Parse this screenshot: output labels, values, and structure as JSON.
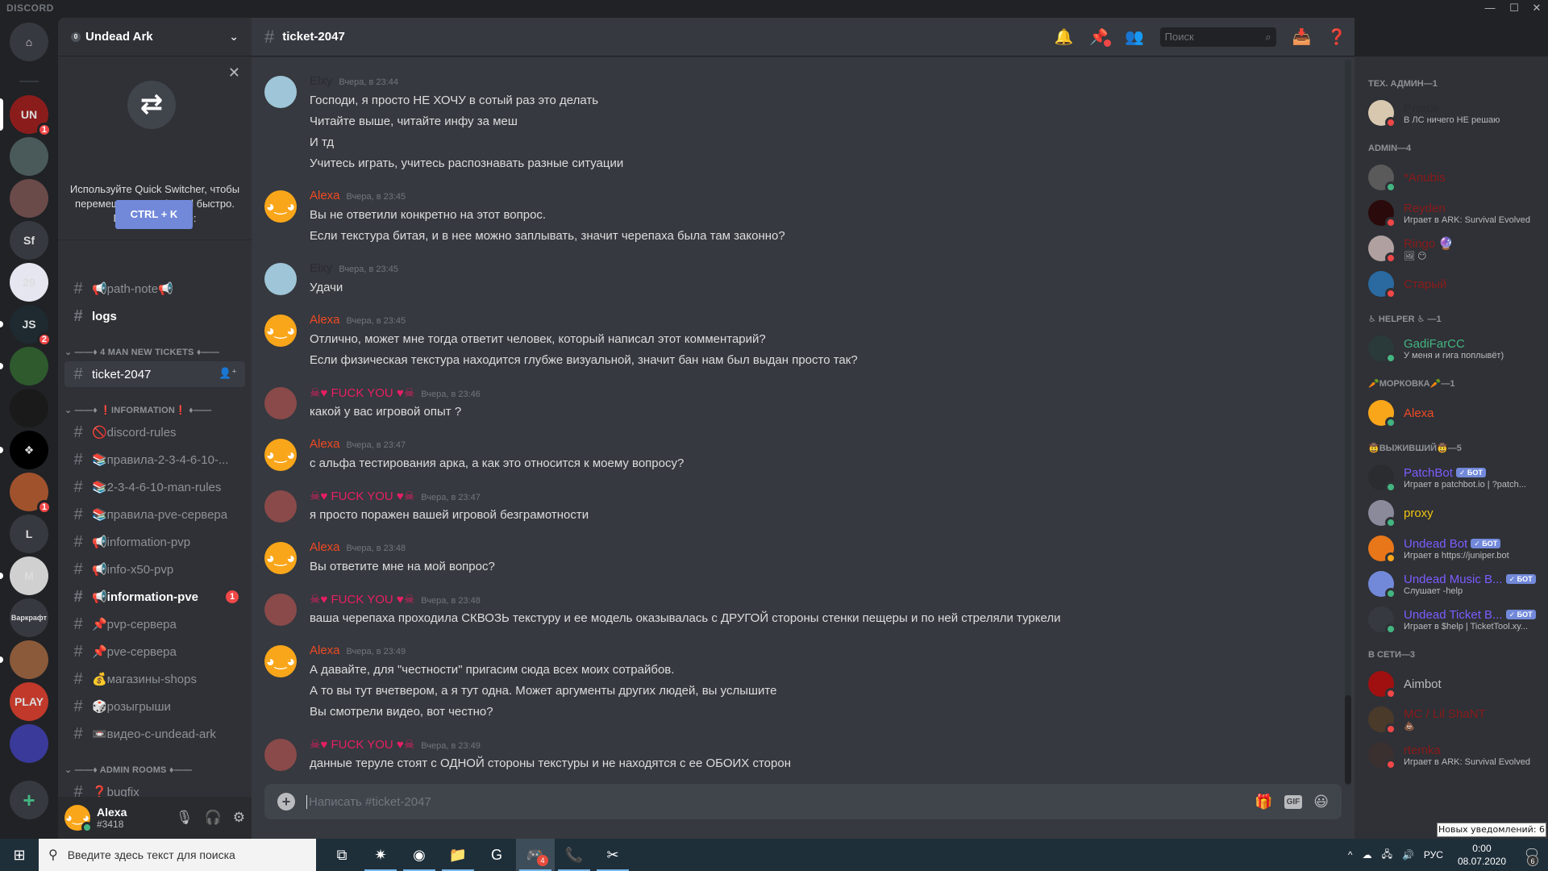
{
  "window": {
    "brand": "DISCORD",
    "minimize": "—",
    "maximize": "☐",
    "close": "✕"
  },
  "servers": [
    {
      "label": "⌂",
      "name": "home",
      "bg": "#36393f",
      "badge": null,
      "pill": null
    },
    {
      "label": "UN",
      "name": "server-un",
      "bg": "#8b1c1c",
      "badge": "1",
      "pill": "active"
    },
    {
      "label": "",
      "name": "server-portrait",
      "bg": "#4a5a5a",
      "badge": null,
      "pill": null
    },
    {
      "label": "",
      "name": "server-portrait-2",
      "bg": "#6b4a4a",
      "badge": null,
      "pill": null
    },
    {
      "label": "Sf",
      "name": "server-sf",
      "bg": "#36393f",
      "badge": null,
      "pill": null
    },
    {
      "label": "29",
      "name": "server-29",
      "bg": "#e6e6f0",
      "badge": null,
      "pill": null
    },
    {
      "label": "JS",
      "name": "server-js",
      "bg": "#1e2a30",
      "badge": "2",
      "pill": "unread"
    },
    {
      "label": "",
      "name": "server-frog",
      "bg": "#2e5a2e",
      "badge": null,
      "pill": "unread"
    },
    {
      "label": "",
      "name": "server-badge",
      "bg": "#1a1a1a",
      "badge": null,
      "pill": null
    },
    {
      "label": "❖",
      "name": "server-diamond",
      "bg": "#000000",
      "badge": null,
      "pill": "unread"
    },
    {
      "label": "",
      "name": "server-dst",
      "bg": "#a0522d",
      "badge": "1",
      "pill": null
    },
    {
      "label": "L",
      "name": "server-l",
      "bg": "#36393f",
      "badge": null,
      "pill": null
    },
    {
      "label": "M",
      "name": "server-m",
      "bg": "#d0d0d0",
      "badge": null,
      "pill": "unread"
    },
    {
      "label": "Варкрафт",
      "name": "server-warcraft",
      "bg": "#36393f",
      "badge": null,
      "pill": null
    },
    {
      "label": "",
      "name": "server-cartoon",
      "bg": "#8a5a3a",
      "badge": null,
      "pill": "unread"
    },
    {
      "label": "PLAY",
      "name": "server-play",
      "bg": "#c0392b",
      "badge": null,
      "pill": null
    },
    {
      "label": "",
      "name": "server-hots",
      "bg": "#3a3a9a",
      "badge": null,
      "pill": null
    },
    {
      "label": "+",
      "name": "add-server",
      "bg": "#36393f",
      "badge": null,
      "pill": null
    }
  ],
  "guild": {
    "name": "Undead Ark",
    "boost_level": "0",
    "chevron": "⌄"
  },
  "quick_switcher": {
    "close": "✕",
    "art": "⇄",
    "text": "Используйте Quick Switcher, чтобы перемещаться в Discord быстро. Просто нажмите:",
    "button": "CTRL + K"
  },
  "channel_list": [
    {
      "type": "channel",
      "name": "📢path-note📢",
      "state": "normal"
    },
    {
      "type": "channel",
      "name": "logs",
      "state": "unread"
    },
    {
      "type": "category",
      "name": "⌄ ——♦ 4 MAN NEW TICKETS ♦——"
    },
    {
      "type": "channel",
      "name": "ticket-2047",
      "state": "selected",
      "icon": "🔒#"
    },
    {
      "type": "category",
      "name": "⌄ ——♦ ❗INFORMATION❗ ♦——"
    },
    {
      "type": "channel",
      "name": "🚫discord-rules",
      "state": "normal"
    },
    {
      "type": "channel",
      "name": "📚правила-2-3-4-6-10-...",
      "state": "normal"
    },
    {
      "type": "channel",
      "name": "📚2-3-4-6-10-man-rules",
      "state": "normal"
    },
    {
      "type": "channel",
      "name": "📚правила-pve-сервера",
      "state": "normal"
    },
    {
      "type": "channel",
      "name": "📢information-pvp",
      "state": "normal"
    },
    {
      "type": "channel",
      "name": "📢info-x50-pvp",
      "state": "normal"
    },
    {
      "type": "channel",
      "name": "📢information-pve",
      "state": "unread",
      "mention": "1"
    },
    {
      "type": "channel",
      "name": "📌pvp-сервера",
      "state": "normal"
    },
    {
      "type": "channel",
      "name": "📌pve-сервера",
      "state": "normal"
    },
    {
      "type": "channel",
      "name": "💰магазины-shops",
      "state": "normal"
    },
    {
      "type": "channel",
      "name": "🎲розыгрыши",
      "state": "normal"
    },
    {
      "type": "channel",
      "name": "📼видео-с-undead-ark",
      "state": "normal"
    },
    {
      "type": "category",
      "name": "⌄ ——♦ ADMIN ROOMS ♦——"
    },
    {
      "type": "channel",
      "name": "❓bugfix",
      "state": "normal"
    }
  ],
  "user_panel": {
    "username": "Alexa",
    "tag": "#3418",
    "mic": "🎙",
    "headphones": "🎧",
    "settings": "⚙"
  },
  "chat": {
    "channel": "ticket-2047",
    "hash": "#",
    "search_placeholder": "Поиск",
    "composer_placeholder": "Написать #ticket-2047",
    "messages": [
      {
        "author": "Elxy",
        "color": "#2a2c30",
        "avatar": "#9fc6d8",
        "time": "Вчера, в 23:44",
        "lines": [
          "Господи, я просто НЕ ХОЧУ в сотый раз это делать",
          "Читайте выше, читайте инфу за меш",
          "И тд",
          "Учитесь играть, учитесь распознавать разные ситуации"
        ]
      },
      {
        "author": "Alexa",
        "color": "#f04a24",
        "avatar": "#faa61a",
        "time": "Вчера, в 23:45",
        "lines": [
          "Вы не ответили конкретно на этот вопрос.",
          "Если текстура битая, и в нее можно заплывать, значит черепаха была там законно?"
        ]
      },
      {
        "author": "Elxy",
        "color": "#2a2c30",
        "avatar": "#9fc6d8",
        "time": "Вчера, в 23:45",
        "lines": [
          "Удачи"
        ]
      },
      {
        "author": "Alexa",
        "color": "#f04a24",
        "avatar": "#faa61a",
        "time": "Вчера, в 23:45",
        "lines": [
          "Отлично, может мне тогда ответит  человек, который написал этот комментарий?",
          "Если физическая текстура находится глубже визуальной, значит бан нам был выдан просто так?"
        ]
      },
      {
        "author": "☠♥ FUCK YOU ♥☠",
        "color": "#e91e63",
        "avatar": "#8a4a4a",
        "time": "Вчера, в 23:46",
        "lines": [
          "какой у вас игровой опыт ?"
        ]
      },
      {
        "author": "Alexa",
        "color": "#f04a24",
        "avatar": "#faa61a",
        "time": "Вчера, в 23:47",
        "lines": [
          "с альфа тестирования арка, а как это относится к моему вопросу?"
        ]
      },
      {
        "author": "☠♥ FUCK YOU ♥☠",
        "color": "#e91e63",
        "avatar": "#8a4a4a",
        "time": "Вчера, в 23:47",
        "lines": [
          "я просто поражен вашей игровой безграмотности"
        ]
      },
      {
        "author": "Alexa",
        "color": "#f04a24",
        "avatar": "#faa61a",
        "time": "Вчера, в 23:48",
        "lines": [
          "Вы ответите мне на мой вопрос?"
        ]
      },
      {
        "author": "☠♥ FUCK YOU ♥☠",
        "color": "#e91e63",
        "avatar": "#8a4a4a",
        "time": "Вчера, в 23:48",
        "lines": [
          "ваша черепаха проходила СКВОЗЬ текстуру и ее модель оказывалась с ДРУГОЙ стороны стенки пещеры и по ней  стреляли туркели"
        ]
      },
      {
        "author": "Alexa",
        "color": "#f04a24",
        "avatar": "#faa61a",
        "time": "Вчера, в 23:49",
        "lines": [
          "А давайте, для \"честности\" пригасим сюда всех моих сотрайбов.",
          "А то вы тут вчетвером, а  я тут одна. Может аргументы других людей, вы услышите",
          "Вы смотрели видео, вот честно?"
        ]
      },
      {
        "author": "☠♥ FUCK YOU ♥☠",
        "color": "#e91e63",
        "avatar": "#8a4a4a",
        "time": "Вчера, в 23:49",
        "lines": [
          "данные теруле стоят с ОДНОЙ стороны текстуры и не находятся с ее ОБОИХ сторон"
        ]
      }
    ]
  },
  "members": {
    "groups": [
      {
        "title": "ТЕХ. АДМИН—1",
        "members": [
          {
            "name": "Prorok",
            "color": "#2a2c30",
            "status": "dnd",
            "activity": "В ЛС ничего НЕ решаю",
            "bot": false,
            "avatar": "#d8c8b0"
          }
        ]
      },
      {
        "title": "ADMIN—4",
        "members": [
          {
            "name": "*Anubis",
            "color": "#8b1a1a",
            "status": "online",
            "activity": "",
            "bot": false,
            "avatar": "#5a5a5a"
          },
          {
            "name": "Reyden",
            "color": "#8b1a1a",
            "status": "dnd",
            "activity": "Играет в ARK: Survival Evolved",
            "bot": false,
            "avatar": "#2a0a0a"
          },
          {
            "name": "Ringo 🔮",
            "color": "#8b1a1a",
            "status": "dnd",
            "activity": "🖼 😶",
            "bot": false,
            "avatar": "#b0a0a0"
          },
          {
            "name": "Старый",
            "color": "#8b1a1a",
            "status": "dnd",
            "activity": "",
            "bot": false,
            "avatar": "#2a6aa0"
          }
        ]
      },
      {
        "title": "♿ HELPER ♿ —1",
        "members": [
          {
            "name": "GadiFarCC",
            "color": "#43b581",
            "status": "online",
            "activity": "У меня и гига поплывёт)",
            "bot": false,
            "avatar": "#2a3a3a"
          }
        ]
      },
      {
        "title": "🥕МОРКОВКА🥕—1",
        "members": [
          {
            "name": "Alexa",
            "color": "#f04a24",
            "status": "online",
            "activity": "",
            "bot": false,
            "avatar": "#faa61a"
          }
        ]
      },
      {
        "title": "🤠ВЫЖИВШИЙ🤠—5",
        "members": [
          {
            "name": "PatchBot",
            "color": "#7d5cff",
            "status": "online",
            "activity": "Играет в patchbot.io | ?patch...",
            "bot": true,
            "avatar": "#2a2c30"
          },
          {
            "name": "proxy",
            "color": "#f1c40f",
            "status": "online",
            "activity": "",
            "bot": false,
            "avatar": "#8a8a9a"
          },
          {
            "name": "Undead Bot",
            "color": "#7d5cff",
            "status": "idle",
            "activity": "Играет в https://juniper.bot",
            "bot": true,
            "avatar": "#e8771a"
          },
          {
            "name": "Undead Music B...",
            "color": "#7d5cff",
            "status": "online",
            "activity": "Слушает -help",
            "bot": true,
            "avatar": "#7289da"
          },
          {
            "name": "Undead Ticket B...",
            "color": "#7d5cff",
            "status": "online",
            "activity": "Играет в $help | TicketTool.xy...",
            "bot": true,
            "avatar": "#36393f"
          }
        ]
      },
      {
        "title": "В СЕТИ—3",
        "members": [
          {
            "name": "Aimbot",
            "color": "#b9bbbe",
            "status": "dnd",
            "activity": "",
            "bot": false,
            "avatar": "#a01010"
          },
          {
            "name": "MC / Lil ShaNT",
            "color": "#8b1a1a",
            "status": "dnd",
            "activity": "💩",
            "bot": false,
            "avatar": "#4a3a2a"
          },
          {
            "name": "rtemka",
            "color": "#8b1a1a",
            "status": "dnd",
            "activity": "Играет в ARK: Survival Evolved",
            "bot": false,
            "avatar": "#3a3030"
          }
        ]
      }
    ],
    "bot_label": "✓ БОТ"
  },
  "tooltip": "Новых уведомлений: 6",
  "taskbar": {
    "search_placeholder": "Введите здесь текст для поиска",
    "apps": [
      {
        "name": "task-view",
        "glyph": "⧉",
        "active": false,
        "badge": null,
        "underline": false
      },
      {
        "name": "battlenet",
        "glyph": "✷",
        "active": false,
        "badge": null,
        "underline": true
      },
      {
        "name": "chrome",
        "glyph": "◉",
        "active": false,
        "badge": null,
        "underline": true
      },
      {
        "name": "file-explorer",
        "glyph": "📁",
        "active": false,
        "badge": null,
        "underline": true
      },
      {
        "name": "logitech-g",
        "glyph": "G",
        "active": false,
        "badge": null,
        "underline": false
      },
      {
        "name": "discord",
        "glyph": "🎮",
        "active": true,
        "badge": "4",
        "underline": true
      },
      {
        "name": "viber",
        "glyph": "📞",
        "active": false,
        "badge": null,
        "underline": true
      },
      {
        "name": "snipping-tool",
        "glyph": "✂",
        "active": false,
        "badge": null,
        "underline": true
      }
    ],
    "tray": {
      "chevron": "^",
      "cloud": "☁",
      "network": "🖧",
      "volume": "🔊",
      "lang": "РУС",
      "time": "0:00",
      "date": "08.07.2020",
      "notif_count": "6"
    }
  }
}
